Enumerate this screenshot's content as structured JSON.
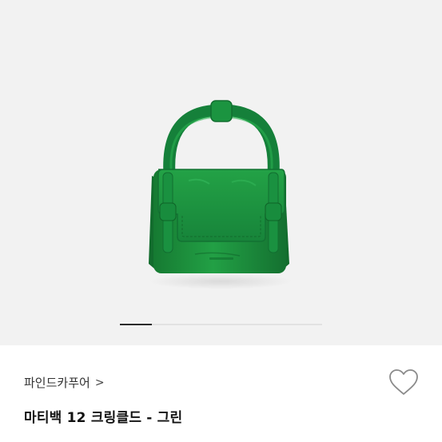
{
  "product": {
    "brand": "파인드카푸어",
    "brand_chevron": ">",
    "title": "마티백 12 크링클드 - 그린"
  },
  "gallery": {
    "progress": 0.16
  },
  "icons": {
    "brand_chevron": "chevron-right-icon",
    "wishlist": "heart-outline-icon"
  },
  "colors": {
    "bag_green": "#1f8a3c",
    "background": "#f2f2f2"
  }
}
